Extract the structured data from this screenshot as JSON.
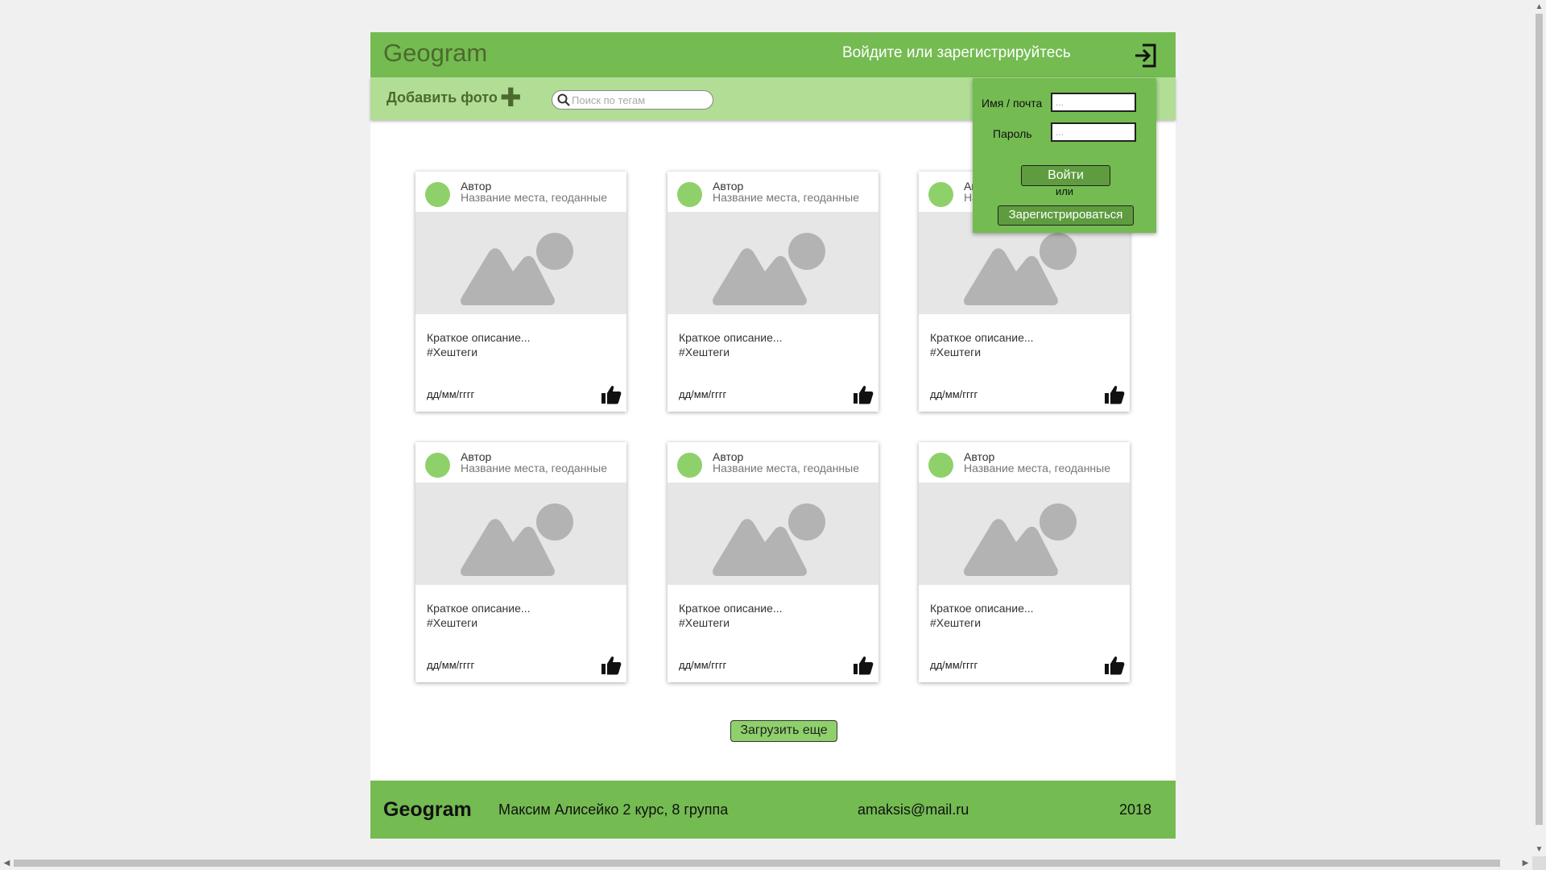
{
  "header": {
    "logo": "Geogram",
    "login_prompt": "Войдите или зарегистрируйтесь",
    "login_icon": "sign-in-icon"
  },
  "toolbar": {
    "add_photo_label": "Добавить фото",
    "add_icon": "plus-icon",
    "search_placeholder": "Поиск по тегам",
    "search_icon": "search-icon"
  },
  "cards": [
    {
      "author": "Автор",
      "place": "Название места, геоданные",
      "description": "Краткое описание...",
      "tags": "#Хештеги",
      "date": "дд/мм/гггг"
    },
    {
      "author": "Автор",
      "place": "Название места, геоданные",
      "description": "Краткое описание...",
      "tags": "#Хештеги",
      "date": "дд/мм/гггг"
    },
    {
      "author": "Автор",
      "place": "Название места, геоданные",
      "description": "Краткое описание...",
      "tags": "#Хештеги",
      "date": "дд/мм/гггг"
    },
    {
      "author": "Автор",
      "place": "Название места, геоданные",
      "description": "Краткое описание...",
      "tags": "#Хештеги",
      "date": "дд/мм/гггг"
    },
    {
      "author": "Автор",
      "place": "Название места, геоданные",
      "description": "Краткое описание...",
      "tags": "#Хештеги",
      "date": "дд/мм/гггг"
    },
    {
      "author": "Автор",
      "place": "Название места, геоданные",
      "description": "Краткое описание...",
      "tags": "#Хештеги",
      "date": "дд/мм/гггг"
    }
  ],
  "load_more_label": "Загрузить еще",
  "login_popup": {
    "username_label": "Имя / почта",
    "username_placeholder": "...",
    "password_label": "Пароль",
    "password_placeholder": "...",
    "login_button": "Войти",
    "or_text": "или",
    "register_button": "Зарегистрироваться"
  },
  "footer": {
    "logo": "Geogram",
    "author": "Максим Алисейко  2 курс, 8 группа",
    "email": "amaksis@mail.ru",
    "year": "2018"
  },
  "colors": {
    "header_green": "#74bb52",
    "toolbar_green": "#b1dd95",
    "avatar_green": "#8ed16b",
    "logo_dark_green": "#4c6a2d",
    "placeholder_gray": "#e6e6e6"
  }
}
